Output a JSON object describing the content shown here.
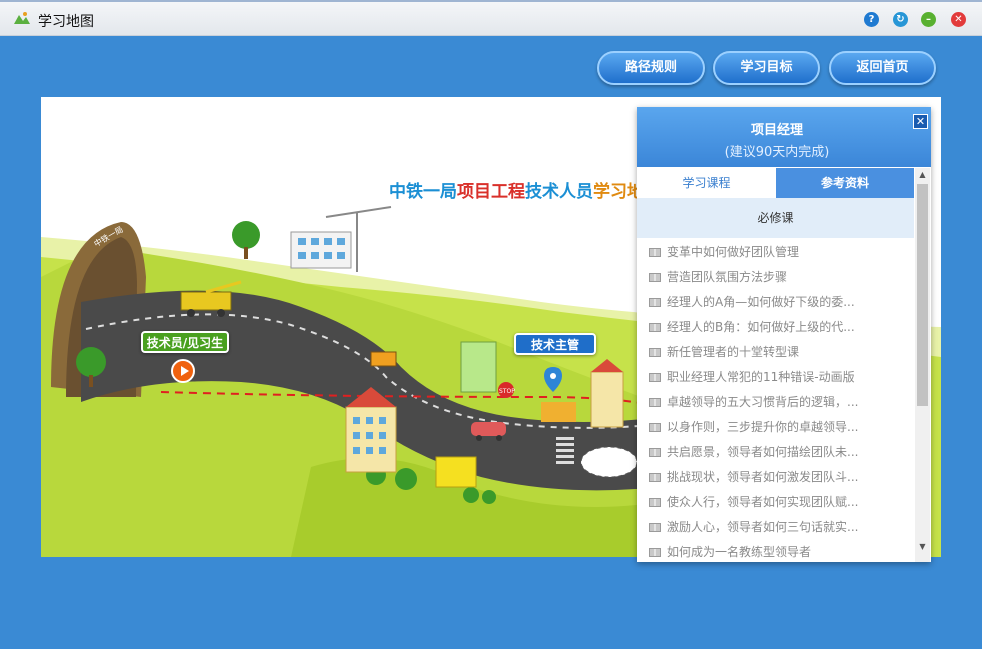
{
  "window": {
    "title": "学习地图",
    "icons": [
      "map-icon",
      "help-icon",
      "refresh-icon",
      "minimize-icon",
      "close-icon"
    ]
  },
  "nav": {
    "path_rules": "路径规则",
    "learning_goals": "学习目标",
    "back_home": "返回首页"
  },
  "map": {
    "title_parts": [
      "中铁一局",
      "项目工程",
      "技术人员",
      "学习地"
    ],
    "tunnel_label": "中铁一局",
    "signs": {
      "technician": "技术员/见习生",
      "tech_supervisor": "技术主管"
    },
    "stop_label": "STOP",
    "colors": {
      "grass": "#c6e24a",
      "road": "#4a4a4a",
      "route": "#e02020"
    }
  },
  "panel": {
    "title": "项目经理",
    "subtitle": "(建议90天内完成)",
    "tabs": [
      "学习课程",
      "参考资料"
    ],
    "active_tab": "参考资料",
    "section_title": "必修课",
    "courses": [
      "变革中如何做好团队管理",
      "营造团队氛围方法步骤",
      "经理人的A角—如何做好下级的委...",
      "经理人的B角：如何做好上级的代...",
      "新任管理者的十堂转型课",
      "职业经理人常犯的11种错误-动画版",
      "卓越领导的五大习惯背后的逻辑，...",
      "以身作则，三步提升你的卓越领导...",
      "共启愿景，领导者如何描绘团队未...",
      "挑战现状，领导者如何激发团队斗...",
      "使众人行，领导者如何实现团队赋...",
      "激励人心，领导者如何三句话就实...",
      "如何成为一名教练型领导者"
    ]
  }
}
